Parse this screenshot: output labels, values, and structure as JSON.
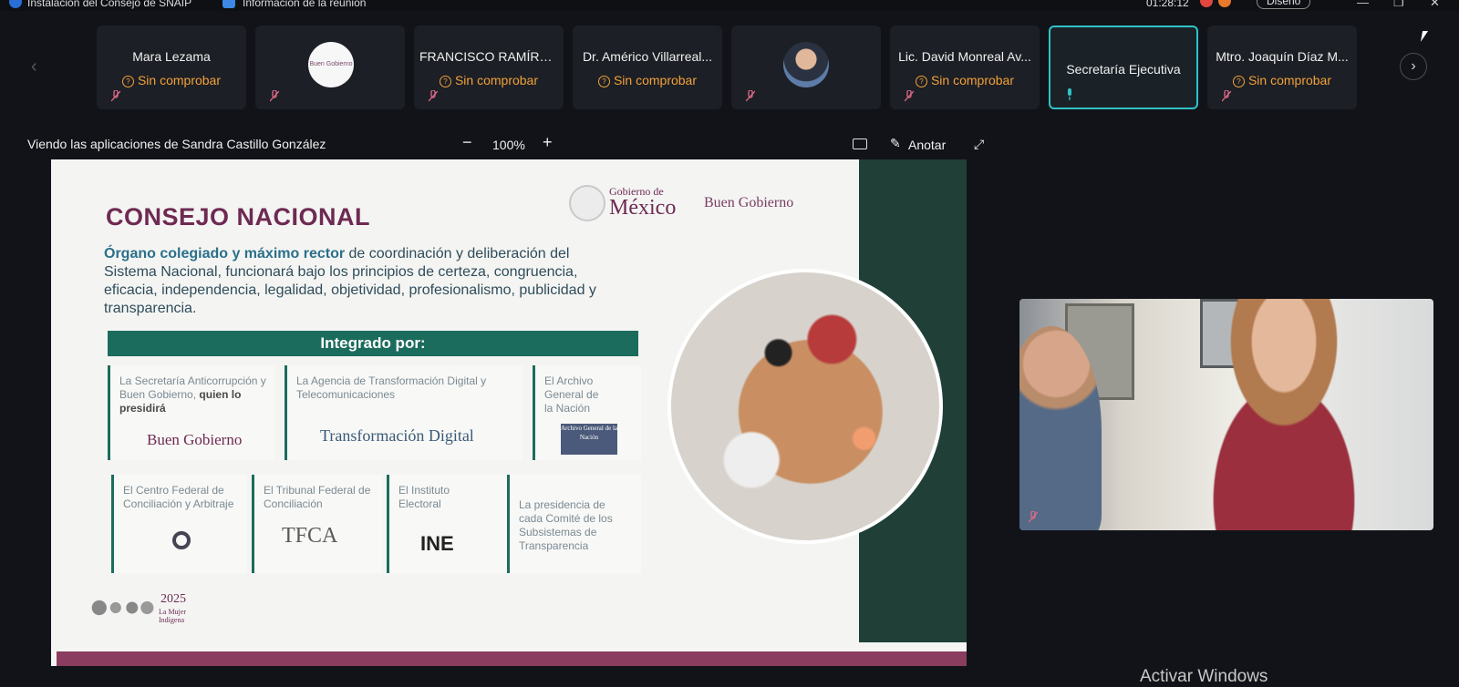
{
  "titlebar": {
    "meeting_title": "Instalación del Consejo de SNAIP",
    "meeting_info": "Información de la reunión",
    "timer": "01:28:12",
    "layout_button": "Diseño"
  },
  "participants": [
    {
      "name": "Mara Lezama",
      "status": "Sin comprobar",
      "kind": "name"
    },
    {
      "name": "",
      "status": "",
      "kind": "logo",
      "logo_text": "Buen Gobierno"
    },
    {
      "name": "FRANCISCO RAMÍRE...",
      "status": "Sin comprobar",
      "kind": "name"
    },
    {
      "name": "Dr. Américo Villarreal...",
      "status": "Sin comprobar",
      "kind": "name"
    },
    {
      "name": "",
      "status": "",
      "kind": "photo"
    },
    {
      "name": "Lic. David Monreal Av...",
      "status": "Sin comprobar",
      "kind": "name"
    },
    {
      "name": "Secretaría Ejecutiva",
      "status": "",
      "kind": "active"
    },
    {
      "name": "Mtro. Joaquín Díaz M...",
      "status": "Sin comprobar",
      "kind": "name"
    }
  ],
  "sharebar": {
    "viewing_text": "Viendo las aplicaciones de Sandra Castillo González",
    "zoom": "100%",
    "annotate": "Anotar"
  },
  "slide": {
    "title": "CONSEJO NACIONAL",
    "gob_de": "Gobierno de",
    "gob_mexico": "México",
    "buen_gobierno_logo": "Buen Gobierno",
    "lead_bold": "Órgano colegiado y máximo rector",
    "lead_rest": "de coordinación y deliberación del Sistema Nacional, funcionará bajo los principios de certeza, congruencia, eficacia, independencia, legalidad, objetividad, profesionalismo, publicidad y transparencia.",
    "integrado": "Integrado por:",
    "cards": [
      {
        "text": "La Secretaría Anticorrupción y Buen Gobierno,",
        "bold": "quien lo presidirá",
        "logo": "Buen Gobierno"
      },
      {
        "text": "La Agencia de Transformación Digital y Telecomunicaciones",
        "logo": "Transformación Digital"
      },
      {
        "text": "El Archivo General de la Nación",
        "logo": "Archivo General de la Nación"
      },
      {
        "text": "El Centro Federal de Conciliación y Arbitraje",
        "logo": ""
      },
      {
        "text": "El Tribunal Federal de Conciliación",
        "logo": "TFCA"
      },
      {
        "text": "El Instituto Electoral",
        "logo": "INE"
      },
      {
        "text": "La presidencia de cada Comité de los Subsistemas de Transparencia",
        "logo": ""
      }
    ],
    "year": "2025",
    "year_caption": "La Mujer Indígena"
  },
  "watermark": "Activar Windows",
  "colors": {
    "accent_cyan": "#31c2c7",
    "warning_orange": "#f2a13a",
    "slide_maroon": "#6e2a52",
    "slide_green": "#1c6c5d"
  }
}
